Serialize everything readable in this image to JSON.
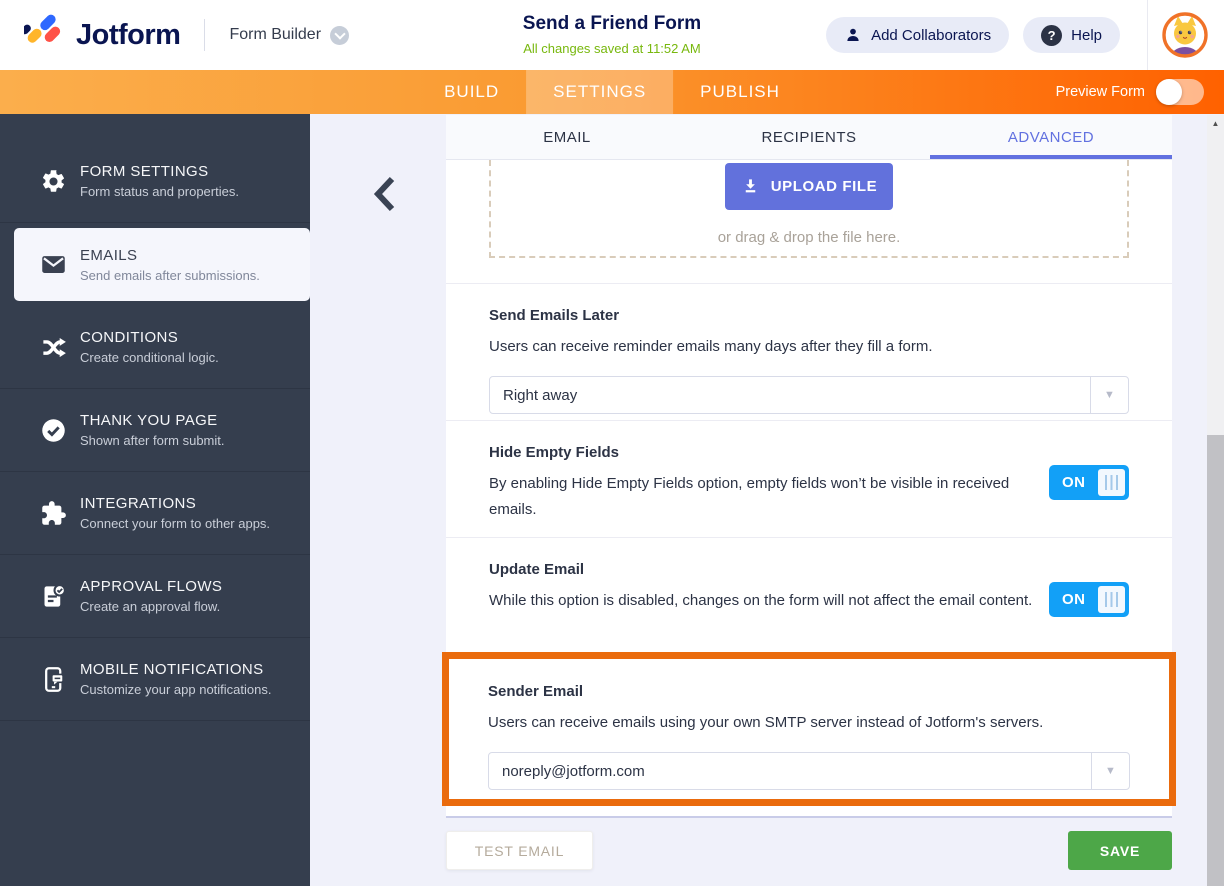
{
  "header": {
    "logo_text": "Jotform",
    "product": "Form Builder",
    "title": "Send a Friend Form",
    "status": "All changes saved at 11:52 AM",
    "add_collaborators_label": "Add Collaborators",
    "help_label": "Help",
    "help_glyph": "?"
  },
  "navbar": {
    "tabs": [
      {
        "label": "BUILD",
        "active": false
      },
      {
        "label": "SETTINGS",
        "active": true
      },
      {
        "label": "PUBLISH",
        "active": false
      }
    ],
    "preview_label": "Preview Form",
    "preview_toggle_state": "off"
  },
  "sidebar": {
    "items": [
      {
        "icon": "gear-icon",
        "label": "FORM SETTINGS",
        "desc": "Form status and properties.",
        "active": false
      },
      {
        "icon": "envelope-icon",
        "label": "EMAILS",
        "desc": "Send emails after submissions.",
        "active": true
      },
      {
        "icon": "shuffle-icon",
        "label": "CONDITIONS",
        "desc": "Create conditional logic.",
        "active": false
      },
      {
        "icon": "check-circle-icon",
        "label": "THANK YOU PAGE",
        "desc": "Shown after form submit.",
        "active": false
      },
      {
        "icon": "puzzle-icon",
        "label": "INTEGRATIONS",
        "desc": "Connect your form to other apps.",
        "active": false
      },
      {
        "icon": "approval-doc-icon",
        "label": "APPROVAL FLOWS",
        "desc": "Create an approval flow.",
        "active": false
      },
      {
        "icon": "mobile-chat-icon",
        "label": "MOBILE NOTIFICATIONS",
        "desc": "Customize your app notifications.",
        "active": false
      }
    ]
  },
  "content": {
    "tabs": [
      {
        "label": "EMAIL",
        "active": false
      },
      {
        "label": "RECIPIENTS",
        "active": false
      },
      {
        "label": "ADVANCED",
        "active": true
      }
    ],
    "upload": {
      "button_label": "UPLOAD FILE",
      "hint": "or drag & drop the file here."
    },
    "sections": [
      {
        "title": "Send Emails Later",
        "desc": "Users can receive reminder emails many days after they fill a form.",
        "control": "select",
        "value": "Right away"
      },
      {
        "title": "Hide Empty Fields",
        "desc": "By enabling Hide Empty Fields option, empty fields won’t be visible in received emails.",
        "control": "toggle",
        "value": "ON"
      },
      {
        "title": "Update Email",
        "desc": "While this option is disabled, changes on the form will not affect the email content.",
        "control": "toggle",
        "value": "ON"
      },
      {
        "title": "Sender Email",
        "desc": "Users can receive emails using your own SMTP server instead of Jotform's servers.",
        "control": "select",
        "value": "noreply@jotform.com",
        "highlighted": true
      }
    ],
    "footer": {
      "test_button": "TEST EMAIL",
      "save_button": "SAVE"
    },
    "select_arrow_glyph": "▼",
    "scroll_up_glyph": "▲"
  },
  "colors": {
    "brand_navy": "#0A1551",
    "nav_gradient_start": "#FBAE4C",
    "nav_gradient_end": "#FF6100",
    "sidebar_bg": "#353E4E",
    "accent_indigo": "#6271E0",
    "toggle_blue": "#12A0F7",
    "save_green": "#4DA748",
    "highlight_orange": "#EA6B0D",
    "status_green": "#78B80E"
  }
}
